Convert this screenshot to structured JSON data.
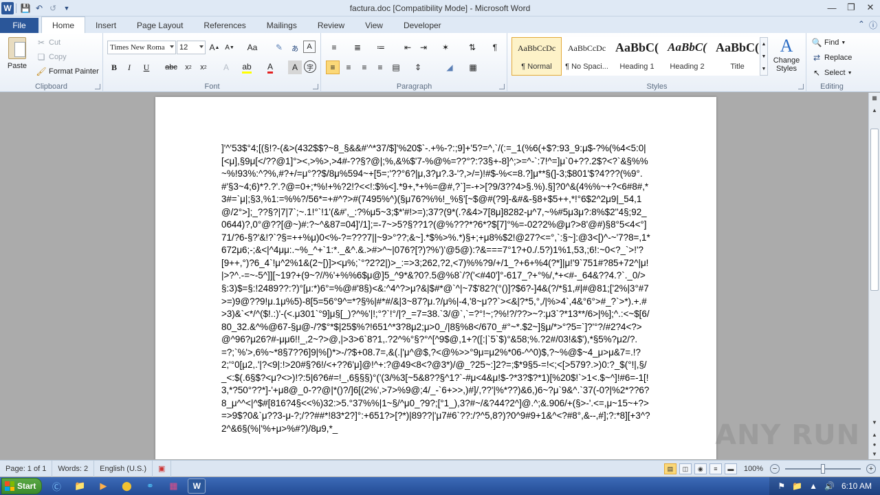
{
  "window": {
    "title": "factura.doc [Compatibility Mode]  -  Microsoft Word",
    "app_icon": "W"
  },
  "quick_access": {
    "icons": [
      "save-icon",
      "undo-icon",
      "redo-icon",
      "customize-icon"
    ]
  },
  "tabs": {
    "file": "File",
    "items": [
      "Home",
      "Insert",
      "Page Layout",
      "References",
      "Mailings",
      "Review",
      "View",
      "Developer"
    ],
    "active": "Home"
  },
  "ribbon": {
    "clipboard": {
      "label": "Clipboard",
      "paste": "Paste",
      "cut": "Cut",
      "copy": "Copy",
      "format_painter": "Format Painter"
    },
    "font": {
      "label": "Font",
      "font_name": "Times New Roma",
      "font_size": "12"
    },
    "paragraph": {
      "label": "Paragraph"
    },
    "styles": {
      "label": "Styles",
      "items": [
        {
          "sample": "AaBbCcDc",
          "name": "¶ Normal"
        },
        {
          "sample": "AaBbCcDc",
          "name": "¶ No Spaci..."
        },
        {
          "sample": "AaBbC(",
          "name": "Heading 1"
        },
        {
          "sample": "AaBbC(",
          "name": "Heading 2"
        },
        {
          "sample": "AaBbC(",
          "name": "Title"
        }
      ],
      "change_styles": "Change Styles"
    },
    "editing": {
      "label": "Editing",
      "find": "Find",
      "replace": "Replace",
      "select": "Select"
    }
  },
  "document": {
    "text": "]'^'53$°4;[(§!?-(&>(432$$?~8_§&&#'^*37/$]'%20$`-.+%-?:;9]+'5?=^,`/(:=_1(%6(+$?:93_9:μ$-?%(%4<5:0|[<μ],§9μ[</??@1]°><,>%>,>4#-??§?@|;%,&%$'7-%@%=??°?:?3§+-8]^;>=^-`:7!^=]μ`0+??.2$?<?`&§%%~%!93%:^?%,#?+/=μ°??$/8μ%594~+[5=;'??°6?|μ,3?μ?.3-'?,>/=)!#$-%<=8.?]μ**§(]-3;$801'$?4???(%9°.#'§3~4;6)*?.?'.?@=0+;*%!+%?2!?<<!:$%<].*9+,*+%=@#,?`]=-+>[?9/3??4>§.%).§]?0^&(4%%~+?<6#8#,*3#=`μ|;§3,%1:=%%?/56*=+#^?>#(7495%^)(§μ76?%%!_%§'[~$@#(?9]-&#&-§8+$5++,*!°6$2^2μ9|_54,1@/2°>];_??§?|7|7`;~.1!°`!1'(&#',_:?%μ5~3;$*'#!>=);37?(9*(.?&4>7[8μ]8282-μ^7,~%#5μ3μ?:8%$2''4§;92_0644)?,0°@??[@~)#:?~^&87=04]'/1];=-7~>5?§??1?(@%???*?6*?$[7]°%=-02?2%@μ?>8'@#)§8°5<4<°]71/?6-§?'&!?`?§=++%μ)0<%-?=???7||~9>°??;&~].*$%>%.*)§+;+μ8%$2!@27?<=°,`:§~]:@3<[)^-~'7?8=,1*672μ6;-;&<|^4μμ:.~%_^+`1:*._&^.&.>#>^~|076?[?)?%')'@5@):?&===7°1?+0./.5?)1%1,53,;6!:~0<?_`>!'?[9++,°)?6_4`!μ^2%1&(2~[)]><μ%;`°?2?2|)>_:=>3;262,?2,<7)%%?9/+/1_?+6+%4(?*]|μ!'9`751#?85+72^|μ!|>?^.-=~-5^]][~19?+(9~?//%'+%%6$μ@]5_^9*&?0?.5@%8`/?('<#40']°-617_?+°%/,*+<#-_64&??4.?`._0/>§:3)$=§:!2489??:?)°[μ:*)6°=%@#'8§)<&:^4^?>μ?&|$#*@`^|~7$'82?(°()]?$6?-]4&(?/*§1,#|#@81;['2%|3°#7>=)9@??9!μ.1μ%5)-8[5=56°9^=*?§%|#*#/&|3~87?μ.?/μ%|-4,'8~μ??`><&|?*5,°,/|%>4`,4&°6°>#_?`>*).+.#>3)&`<*/^($!.:)'-(<.μ301`°9]μ§[_)?^%'|!;°?`!°/|?_=7=38.`3/@`,`=?°!~;?%!?/??>~?:μ3`?*13**/6>|%];^.:<~$[6/80_32.&^%@67-§μ@-/?$°*$|25$%?!651^*3?8μ2;μ>0_/|8§%8</670_#°~*.$2~]§μ/*>°?5=`]?'°?/#2?4<?>@^96?μ26?#-μμ6!!_,2~?>@,|>3>6`8?1,.?2^%°§?°^[^9$@,1+?([:|`5`$)°&58;%.?2#/03!&$'),*§5%?μ2/?.=?;`%'>,6%~*8§7??6]9|%[)*>-/?$+08.7=,&(.|'μ^@$,?<@%>>°9μ=μ2%*06-^^0)$,?~%@$~4_μ>μ&7=.!?2;'°0[μ2,.'|?<9|:!>20#§?6!/<+??6'μ]@!^+:?@49<8<?@3*)/@_?25~:]2?=;$*9§5-=!<;<[>579?.>)0:?_$(°!|,§/_<:$(.6§$?<μ?<>)!?:5|6?6#=!_,6§§§)°('(3/%3[~5&8??§^1?`-#μ<4&μ!$-?*3?$?*1)[%20$!`>1<.$~^]!#6=-1[!3,*?50°??*]-'+μ8@_0-??@|*()?/]6[(2%',>7>%9@;4/_-`6+>>,)#]/,??'|%*??)&6,)6~?μ`9&^.`37(-0?|%2*??6?8_μ^^<|^$#[816?4§<<%)32:>5.°37%%|1~§/^μ0_?9?;[°1_),3?#~/&?44?2^]@.^;&.906/+(§>-'.<=,μ~15~+?>=>9$?0&`μ??3-μ-?;/??##*!83*2?]°:+651?>[?*)|89??|'μ7#6`??:/?^5,8?)?0^9#9+1&^<?#8°,&--,#];?:*8][+3^?2^&6§(%|'%+μ>%#?)/8μ9,*_"
  },
  "status": {
    "page": "Page: 1 of 1",
    "words": "Words: 2",
    "language": "English (U.S.)",
    "zoom": "100%"
  },
  "taskbar": {
    "start": "Start",
    "clock": "6:10 AM"
  },
  "watermark": "ANY RUN"
}
